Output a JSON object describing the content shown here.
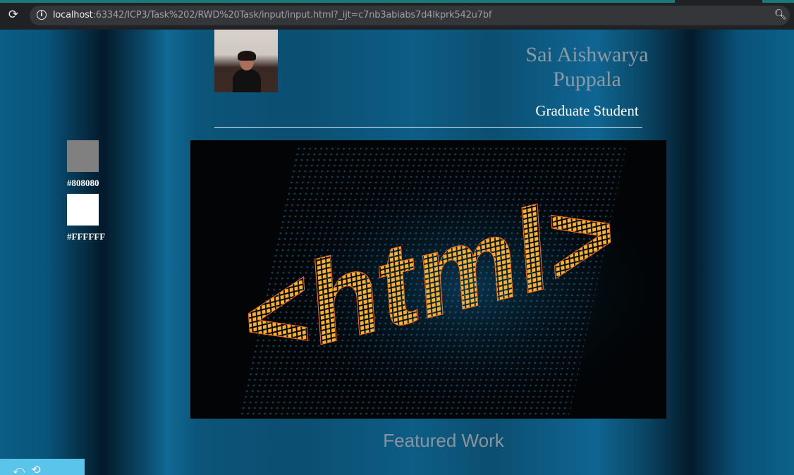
{
  "browser": {
    "url_host": "localhost",
    "url_rest": ":63342/ICP3/Task%202/RWD%20Task/input/input.html?_ijt=c7nb3abiabs7d4lkprk542u7bf"
  },
  "header": {
    "name": "Sai Aishwarya Puppala",
    "role": "Graduate Student"
  },
  "swatches": [
    {
      "color": "#808080",
      "label": "#808080"
    },
    {
      "color": "#FFFFFF",
      "label": "#FFFFFF"
    }
  ],
  "hero": {
    "text": "<html>"
  },
  "featured_heading": "Featured Work"
}
